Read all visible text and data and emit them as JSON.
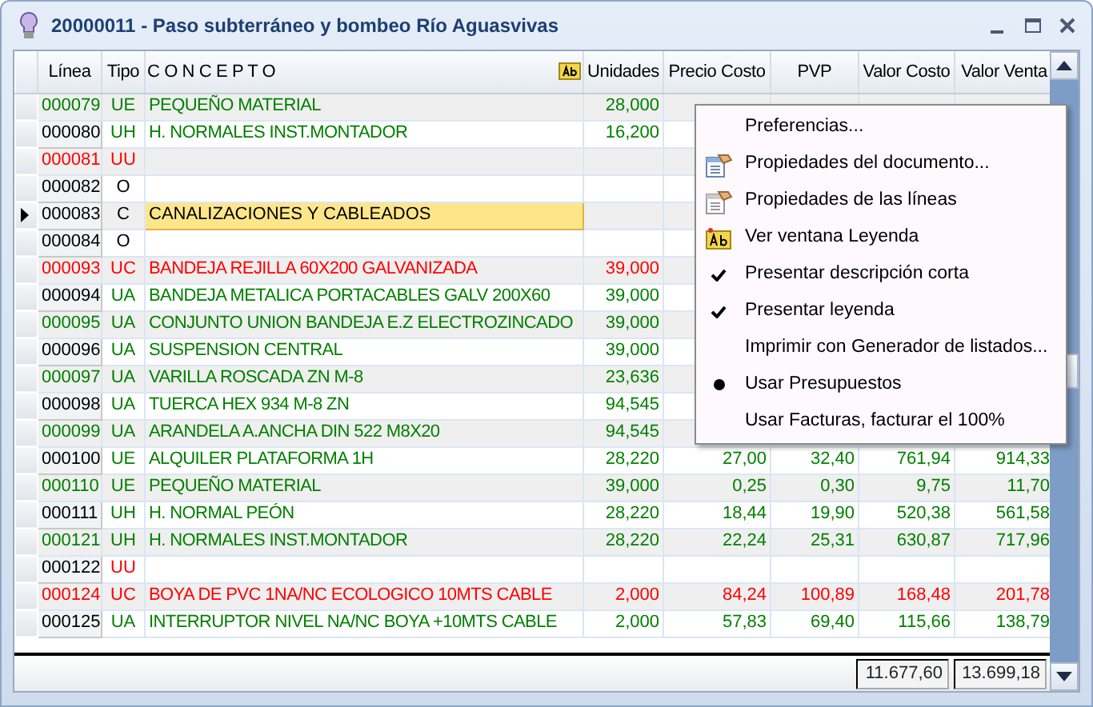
{
  "window": {
    "title": "20000011 - Paso subterráneo y bombeo Río Aguasvivas"
  },
  "table": {
    "columns": [
      "Línea",
      "Tipo",
      "C O N C E P T O",
      "Unidades",
      "Precio Costo",
      "PVP",
      "Valor Costo",
      "Valor Venta"
    ],
    "rows": [
      {
        "line": "000079",
        "type": "UE",
        "concept": "PEQUEÑO MATERIAL",
        "units": "28,000",
        "color": "#008000",
        "line_boxed": false,
        "selected": false
      },
      {
        "line": "000080",
        "type": "UH",
        "concept": "H. NORMALES INST.MONTADOR",
        "units": "16,200",
        "color": "#008000",
        "line_boxed": true,
        "selected": false
      },
      {
        "line": "000081",
        "type": "UU",
        "concept": "",
        "units": "",
        "color": "#ff0000",
        "line_boxed": false,
        "selected": false
      },
      {
        "line": "000082",
        "type": "O",
        "concept": "",
        "units": "",
        "color": "#000000",
        "line_boxed": true,
        "selected": false
      },
      {
        "line": "000083",
        "type": "C",
        "concept": "CANALIZACIONES Y CABLEADOS",
        "units": "",
        "color": "#000000",
        "line_boxed": true,
        "selected": true
      },
      {
        "line": "000084",
        "type": "O",
        "concept": "",
        "units": "",
        "color": "#000000",
        "line_boxed": true,
        "selected": false
      },
      {
        "line": "000093",
        "type": "UC",
        "concept": "BANDEJA REJILLA 60X200  GALVANIZADA",
        "units": "39,000",
        "color": "#ff0000",
        "line_boxed": false,
        "selected": false
      },
      {
        "line": "000094",
        "type": "UA",
        "concept": "BANDEJA METALICA PORTACABLES GALV 200X60",
        "units": "39,000",
        "color": "#008000",
        "line_boxed": true,
        "selected": false
      },
      {
        "line": "000095",
        "type": "UA",
        "concept": "CONJUNTO UNION BANDEJA E.Z ELECTROZINCADO",
        "units": "39,000",
        "color": "#008000",
        "line_boxed": false,
        "selected": false
      },
      {
        "line": "000096",
        "type": "UA",
        "concept": "SUSPENSION CENTRAL",
        "units": "39,000",
        "color": "#008000",
        "line_boxed": true,
        "selected": false
      },
      {
        "line": "000097",
        "type": "UA",
        "concept": "VARILLA ROSCADA ZN M-8",
        "units": "23,636",
        "color": "#008000",
        "line_boxed": false,
        "selected": false
      },
      {
        "line": "000098",
        "type": "UA",
        "concept": "TUERCA HEX 934 M-8 ZN",
        "units": "94,545",
        "color": "#008000",
        "line_boxed": true,
        "selected": false
      },
      {
        "line": "000099",
        "type": "UA",
        "concept": "ARANDELA A.ANCHA DIN 522 M8X20",
        "units": "94,545",
        "color": "#008000",
        "line_boxed": false,
        "selected": false
      },
      {
        "line": "000100",
        "type": "UE",
        "concept": "ALQUILER PLATAFORMA 1H",
        "units": "28,220",
        "cost_price": "27,00",
        "pvp": "32,40",
        "cost_value": "761,94",
        "sale_value": "914,33",
        "color": "#008000",
        "line_boxed": true,
        "selected": false
      },
      {
        "line": "000110",
        "type": "UE",
        "concept": "PEQUEÑO MATERIAL",
        "units": "39,000",
        "cost_price": "0,25",
        "pvp": "0,30",
        "cost_value": "9,75",
        "sale_value": "11,70",
        "color": "#008000",
        "line_boxed": false,
        "selected": false
      },
      {
        "line": "000111",
        "type": "UH",
        "concept": "H. NORMAL PEÓN",
        "units": "28,220",
        "cost_price": "18,44",
        "pvp": "19,90",
        "cost_value": "520,38",
        "sale_value": "561,58",
        "color": "#008000",
        "line_boxed": true,
        "selected": false
      },
      {
        "line": "000121",
        "type": "UH",
        "concept": "H. NORMALES INST.MONTADOR",
        "units": "28,220",
        "cost_price": "22,24",
        "pvp": "25,31",
        "cost_value": "630,87",
        "sale_value": "717,96",
        "color": "#008000",
        "line_boxed": false,
        "selected": false
      },
      {
        "line": "000122",
        "type": "UU",
        "concept": "",
        "units": "",
        "color": "#ff0000",
        "line_boxed": true,
        "selected": false
      },
      {
        "line": "000124",
        "type": "UC",
        "concept": "BOYA DE PVC 1NA/NC ECOLOGICO 10MTS CABLE",
        "units": "2,000",
        "cost_price": "84,24",
        "pvp": "100,89",
        "cost_value": "168,48",
        "sale_value": "201,78",
        "color": "#ff0000",
        "line_boxed": false,
        "selected": false
      },
      {
        "line": "000125",
        "type": "UA",
        "concept": "INTERRUPTOR NIVEL NA/NC BOYA +10MTS CABLE",
        "units": "2,000",
        "cost_price": "57,83",
        "pvp": "69,40",
        "cost_value": "115,66",
        "sale_value": "138,79",
        "color": "#008000",
        "line_boxed": true,
        "selected": false
      }
    ]
  },
  "totals": {
    "cost_value": "11.677,60",
    "sale_value": "13.699,18"
  },
  "context_menu": [
    {
      "label": "Preferencias...",
      "kind": "plain"
    },
    {
      "label": "Propiedades del documento...",
      "kind": "doc"
    },
    {
      "label": "Propiedades de las líneas",
      "kind": "lines"
    },
    {
      "label": "Ver ventana Leyenda",
      "kind": "legend"
    },
    {
      "label": "Presentar descripción corta",
      "kind": "check",
      "checked": true
    },
    {
      "label": "Presentar leyenda",
      "kind": "check",
      "checked": true
    },
    {
      "label": "Imprimir con Generador de listados...",
      "kind": "plain"
    },
    {
      "label": "Usar Presupuestos",
      "kind": "radio",
      "checked": true
    },
    {
      "label": "Usar Facturas, facturar el 100%",
      "kind": "radio",
      "checked": false
    }
  ]
}
